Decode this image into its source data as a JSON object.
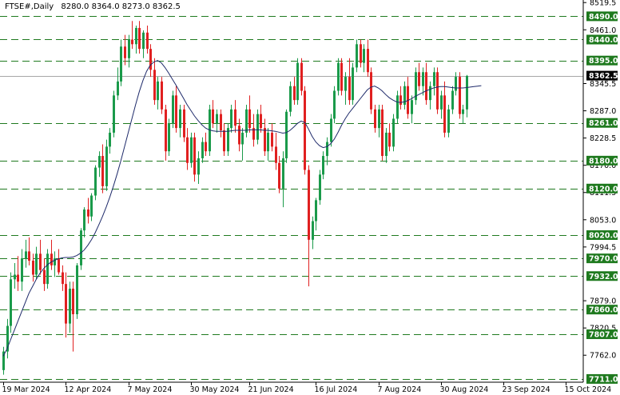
{
  "header": {
    "symbol": "FTSE#,Daily",
    "ohlc": "8280.0 8364.0 8273.0 8362.5"
  },
  "colors": {
    "bull": "#1a9a4a",
    "bear": "#e02020",
    "ma": "#1e2a6a",
    "level": "#1f7a1f",
    "badge_bg": "#1f7a1f",
    "badge_text": "#ffffff",
    "current_bg": "#000000"
  },
  "chart_data": {
    "type": "candlestick",
    "ylim": [
      7704,
      8525
    ],
    "y_ticks": [
      "8519.5",
      "8461.0",
      "8345.5",
      "8287.0",
      "8228.5",
      "8170.0",
      "8111.5",
      "8053.0",
      "7994.5",
      "7879.0",
      "7820.5",
      "7762.0"
    ],
    "x_tick_labels": [
      "19 Mar 2024",
      "12 Apr 2024",
      "7 May 2024",
      "30 May 2024",
      "21 Jun 2024",
      "16 Jul 2024",
      "7 Aug 2024",
      "30 Aug 2024",
      "23 Sep 2024",
      "15 Oct 2024"
    ],
    "x_tick_index": [
      0,
      17,
      34,
      51,
      67,
      85,
      102,
      119,
      136,
      153
    ],
    "levels": [
      "8490.0",
      "8440.0",
      "8395.0",
      "8261.0",
      "8180.0",
      "8120.0",
      "8020.0",
      "7970.0",
      "7932.0",
      "7860.0",
      "7807.0",
      "7711.0"
    ],
    "current_price": "8362.5",
    "candles": [
      [
        7730,
        7780,
        7720,
        7770
      ],
      [
        7770,
        7840,
        7755,
        7825
      ],
      [
        7825,
        7940,
        7810,
        7925
      ],
      [
        7925,
        7960,
        7905,
        7935
      ],
      [
        7935,
        7975,
        7900,
        7920
      ],
      [
        7920,
        7990,
        7900,
        7970
      ],
      [
        7970,
        8010,
        7950,
        7985
      ],
      [
        7985,
        8015,
        7955,
        7965
      ],
      [
        7965,
        7980,
        7920,
        7935
      ],
      [
        7935,
        7995,
        7925,
        7980
      ],
      [
        7980,
        8010,
        7935,
        7945
      ],
      [
        7945,
        7970,
        7900,
        7915
      ],
      [
        7915,
        7990,
        7905,
        7980
      ],
      [
        7980,
        8010,
        7945,
        7955
      ],
      [
        7955,
        7985,
        7930,
        7970
      ],
      [
        7970,
        7990,
        7935,
        7940
      ],
      [
        7940,
        7955,
        7900,
        7915
      ],
      [
        7915,
        7940,
        7800,
        7830
      ],
      [
        7830,
        7920,
        7810,
        7905
      ],
      [
        7905,
        7920,
        7770,
        7850
      ],
      [
        7850,
        7960,
        7840,
        7955
      ],
      [
        7955,
        8035,
        7945,
        8030
      ],
      [
        8030,
        8080,
        8015,
        8075
      ],
      [
        8075,
        8100,
        8045,
        8060
      ],
      [
        8060,
        8110,
        8050,
        8105
      ],
      [
        8105,
        8170,
        8095,
        8165
      ],
      [
        8165,
        8200,
        8145,
        8190
      ],
      [
        8190,
        8215,
        8110,
        8125
      ],
      [
        8125,
        8225,
        8115,
        8210
      ],
      [
        8210,
        8250,
        8195,
        8240
      ],
      [
        8240,
        8330,
        8230,
        8320
      ],
      [
        8320,
        8380,
        8310,
        8350
      ],
      [
        8350,
        8440,
        8340,
        8425
      ],
      [
        8425,
        8450,
        8385,
        8400
      ],
      [
        8400,
        8450,
        8380,
        8440
      ],
      [
        8440,
        8480,
        8420,
        8430
      ],
      [
        8430,
        8470,
        8410,
        8465
      ],
      [
        8465,
        8480,
        8410,
        8420
      ],
      [
        8420,
        8460,
        8400,
        8455
      ],
      [
        8455,
        8470,
        8410,
        8420
      ],
      [
        8420,
        8430,
        8360,
        8375
      ],
      [
        8375,
        8400,
        8300,
        8310
      ],
      [
        8310,
        8360,
        8290,
        8350
      ],
      [
        8350,
        8360,
        8280,
        8290
      ],
      [
        8290,
        8300,
        8180,
        8200
      ],
      [
        8200,
        8270,
        8190,
        8260
      ],
      [
        8260,
        8330,
        8250,
        8320
      ],
      [
        8320,
        8340,
        8240,
        8250
      ],
      [
        8250,
        8300,
        8230,
        8290
      ],
      [
        8290,
        8300,
        8220,
        8230
      ],
      [
        8230,
        8250,
        8160,
        8175
      ],
      [
        8175,
        8240,
        8165,
        8230
      ],
      [
        8230,
        8240,
        8135,
        8150
      ],
      [
        8150,
        8200,
        8130,
        8185
      ],
      [
        8185,
        8230,
        8175,
        8220
      ],
      [
        8220,
        8240,
        8190,
        8200
      ],
      [
        8200,
        8300,
        8190,
        8290
      ],
      [
        8290,
        8310,
        8250,
        8260
      ],
      [
        8260,
        8290,
        8240,
        8280
      ],
      [
        8280,
        8290,
        8230,
        8245
      ],
      [
        8245,
        8260,
        8190,
        8200
      ],
      [
        8200,
        8260,
        8190,
        8250
      ],
      [
        8250,
        8300,
        8240,
        8290
      ],
      [
        8290,
        8310,
        8240,
        8255
      ],
      [
        8255,
        8270,
        8200,
        8215
      ],
      [
        8215,
        8250,
        8180,
        8240
      ],
      [
        8240,
        8300,
        8230,
        8290
      ],
      [
        8290,
        8320,
        8240,
        8250
      ],
      [
        8250,
        8280,
        8210,
        8225
      ],
      [
        8225,
        8290,
        8215,
        8280
      ],
      [
        8280,
        8300,
        8240,
        8250
      ],
      [
        8250,
        8270,
        8190,
        8200
      ],
      [
        8200,
        8250,
        8180,
        8240
      ],
      [
        8240,
        8260,
        8200,
        8210
      ],
      [
        8210,
        8240,
        8160,
        8175
      ],
      [
        8175,
        8190,
        8110,
        8120
      ],
      [
        8120,
        8200,
        8080,
        8185
      ],
      [
        8185,
        8290,
        8175,
        8285
      ],
      [
        8285,
        8350,
        8275,
        8340
      ],
      [
        8340,
        8360,
        8300,
        8310
      ],
      [
        8310,
        8400,
        8300,
        8390
      ],
      [
        8390,
        8400,
        8320,
        8330
      ],
      [
        8330,
        8340,
        8150,
        8160
      ],
      [
        8160,
        8170,
        7910,
        8010
      ],
      [
        8010,
        8060,
        7990,
        8050
      ],
      [
        8050,
        8100,
        8030,
        8095
      ],
      [
        8095,
        8160,
        8085,
        8150
      ],
      [
        8150,
        8200,
        8140,
        8190
      ],
      [
        8190,
        8230,
        8170,
        8220
      ],
      [
        8220,
        8280,
        8210,
        8270
      ],
      [
        8270,
        8340,
        8260,
        8330
      ],
      [
        8330,
        8400,
        8320,
        8390
      ],
      [
        8390,
        8400,
        8320,
        8330
      ],
      [
        8330,
        8370,
        8300,
        8360
      ],
      [
        8360,
        8400,
        8300,
        8310
      ],
      [
        8310,
        8390,
        8300,
        8380
      ],
      [
        8380,
        8440,
        8370,
        8430
      ],
      [
        8430,
        8440,
        8380,
        8390
      ],
      [
        8390,
        8430,
        8370,
        8420
      ],
      [
        8420,
        8440,
        8360,
        8370
      ],
      [
        8370,
        8380,
        8280,
        8290
      ],
      [
        8290,
        8300,
        8240,
        8250
      ],
      [
        8250,
        8300,
        8230,
        8290
      ],
      [
        8290,
        8300,
        8180,
        8190
      ],
      [
        8190,
        8250,
        8175,
        8240
      ],
      [
        8240,
        8260,
        8200,
        8210
      ],
      [
        8210,
        8280,
        8200,
        8270
      ],
      [
        8270,
        8330,
        8260,
        8320
      ],
      [
        8320,
        8340,
        8290,
        8300
      ],
      [
        8300,
        8350,
        8290,
        8340
      ],
      [
        8340,
        8360,
        8270,
        8280
      ],
      [
        8280,
        8320,
        8260,
        8310
      ],
      [
        8310,
        8380,
        8300,
        8370
      ],
      [
        8370,
        8390,
        8330,
        8340
      ],
      [
        8340,
        8380,
        8320,
        8370
      ],
      [
        8370,
        8390,
        8300,
        8310
      ],
      [
        8310,
        8350,
        8290,
        8340
      ],
      [
        8340,
        8380,
        8320,
        8370
      ],
      [
        8370,
        8380,
        8280,
        8290
      ],
      [
        8290,
        8330,
        8270,
        8320
      ],
      [
        8320,
        8350,
        8230,
        8240
      ],
      [
        8240,
        8300,
        8230,
        8290
      ],
      [
        8290,
        8340,
        8280,
        8330
      ],
      [
        8330,
        8370,
        8320,
        8360
      ],
      [
        8360,
        8370,
        8270,
        8280
      ],
      [
        8280,
        8300,
        8260,
        8290
      ],
      [
        8290,
        8364,
        8273,
        8362
      ]
    ],
    "ma": [
      7760,
      7775,
      7795,
      7815,
      7835,
      7855,
      7875,
      7895,
      7910,
      7925,
      7938,
      7948,
      7956,
      7962,
      7966,
      7969,
      7971,
      7972,
      7972,
      7973,
      7976,
      7981,
      7988,
      7998,
      8010,
      8025,
      8042,
      8060,
      8080,
      8102,
      8126,
      8152,
      8180,
      8210,
      8240,
      8270,
      8300,
      8328,
      8352,
      8372,
      8385,
      8392,
      8395,
      8390,
      8380,
      8368,
      8355,
      8342,
      8328,
      8314,
      8300,
      8288,
      8276,
      8266,
      8257,
      8250,
      8246,
      8244,
      8243,
      8243,
      8243,
      8243,
      8244,
      8245,
      8245,
      8245,
      8245,
      8246,
      8246,
      8246,
      8246,
      8245,
      8245,
      8244,
      8243,
      8241,
      8239,
      8240,
      8245,
      8252,
      8260,
      8265,
      8262,
      8248,
      8232,
      8220,
      8212,
      8208,
      8210,
      8216,
      8226,
      8240,
      8256,
      8270,
      8282,
      8292,
      8302,
      8312,
      8322,
      8332,
      8338,
      8340,
      8336,
      8330,
      8322,
      8315,
      8310,
      8306,
      8305,
      8306,
      8309,
      8313,
      8318,
      8322,
      8326,
      8330,
      8333,
      8336,
      8338,
      8339,
      8339,
      8338,
      8337,
      8336,
      8336,
      8336,
      8337,
      8338,
      8339,
      8340,
      8341
    ]
  }
}
